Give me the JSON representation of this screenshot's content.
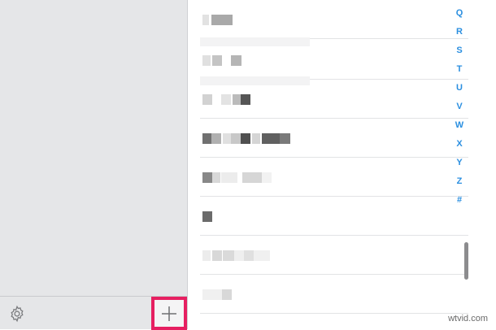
{
  "index_letters": [
    "Q",
    "R",
    "S",
    "T",
    "U",
    "V",
    "W",
    "X",
    "Y",
    "Z",
    "#"
  ],
  "footer": {
    "settings_icon": "gear-icon",
    "add_icon": "plus-icon",
    "highlight_color": "#e61f61"
  },
  "accent_color": "#2b8fe0",
  "watermark": "wtvid.com"
}
